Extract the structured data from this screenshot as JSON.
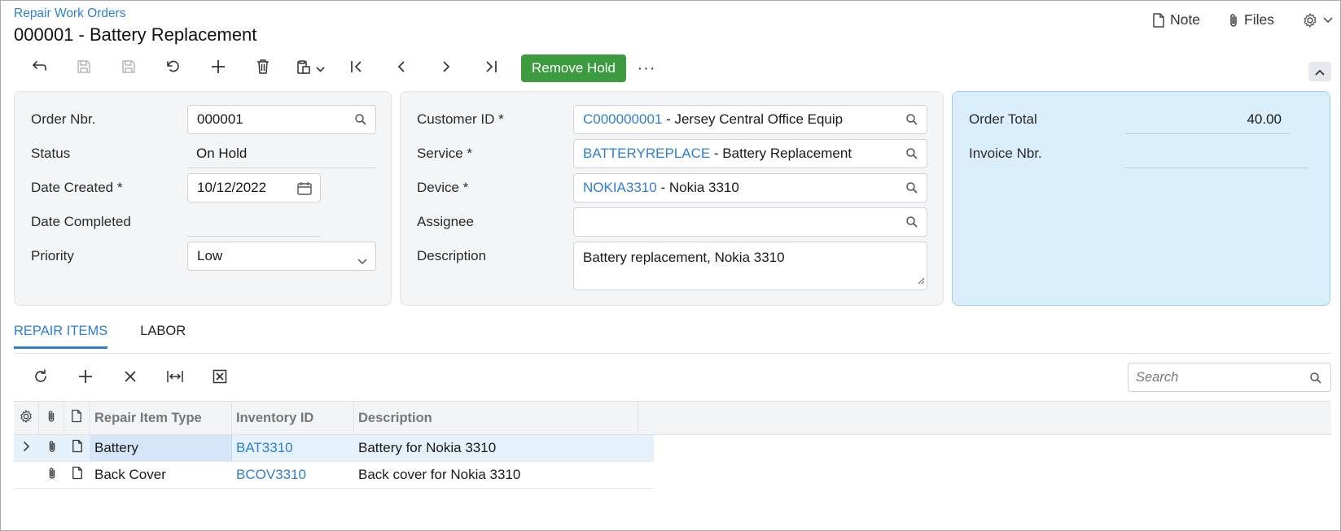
{
  "header": {
    "breadcrumb": "Repair Work Orders",
    "title": "000001 - Battery Replacement",
    "note_label": "Note",
    "files_label": "Files"
  },
  "toolbar": {
    "remove_hold_label": "Remove Hold",
    "more_label": "···"
  },
  "summary_left": {
    "order_nbr_label": "Order Nbr.",
    "order_nbr_value": "000001",
    "status_label": "Status",
    "status_value": "On Hold",
    "date_created_label": "Date Created *",
    "date_created_value": "10/12/2022",
    "date_completed_label": "Date Completed",
    "date_completed_value": "",
    "priority_label": "Priority",
    "priority_value": "Low"
  },
  "summary_mid": {
    "customer_label": "Customer ID *",
    "customer_id": "C000000001",
    "customer_name": " - Jersey Central Office Equip",
    "service_label": "Service *",
    "service_id": "BATTERYREPLACE",
    "service_name": " - Battery Replacement",
    "device_label": "Device *",
    "device_id": "NOKIA3310",
    "device_name": " - Nokia 3310",
    "assignee_label": "Assignee",
    "assignee_value": "",
    "description_label": "Description",
    "description_value": "Battery replacement, Nokia 3310"
  },
  "summary_right": {
    "order_total_label": "Order Total",
    "order_total_value": "40.00",
    "invoice_label": "Invoice Nbr.",
    "invoice_value": ""
  },
  "tabs": [
    {
      "label": "REPAIR ITEMS",
      "active": true
    },
    {
      "label": "LABOR",
      "active": false
    }
  ],
  "grid": {
    "search_placeholder": "Search",
    "columns": [
      "Repair Item Type",
      "Inventory ID",
      "Description"
    ],
    "rows": [
      {
        "type": "Battery",
        "inventory_id": "BAT3310",
        "description": "Battery for Nokia 3310"
      },
      {
        "type": "Back Cover",
        "inventory_id": "BCOV3310",
        "description": "Back cover for Nokia 3310"
      }
    ]
  },
  "colors": {
    "accent": "#2f7fcf",
    "primary_button": "#3d9b3f",
    "highlight_panel": "#dbeefb"
  },
  "icons": [
    "note-icon",
    "paperclip-icon",
    "gear-icon",
    "undo-icon",
    "save-close-icon",
    "save-icon",
    "revert-icon",
    "add-icon",
    "delete-icon",
    "clipboard-icon",
    "first-icon",
    "prev-icon",
    "next-icon",
    "last-icon",
    "search-icon",
    "calendar-icon",
    "chevron-down-icon",
    "refresh-icon",
    "close-icon",
    "fit-columns-icon",
    "excel-icon",
    "expand-icon",
    "document-icon"
  ]
}
